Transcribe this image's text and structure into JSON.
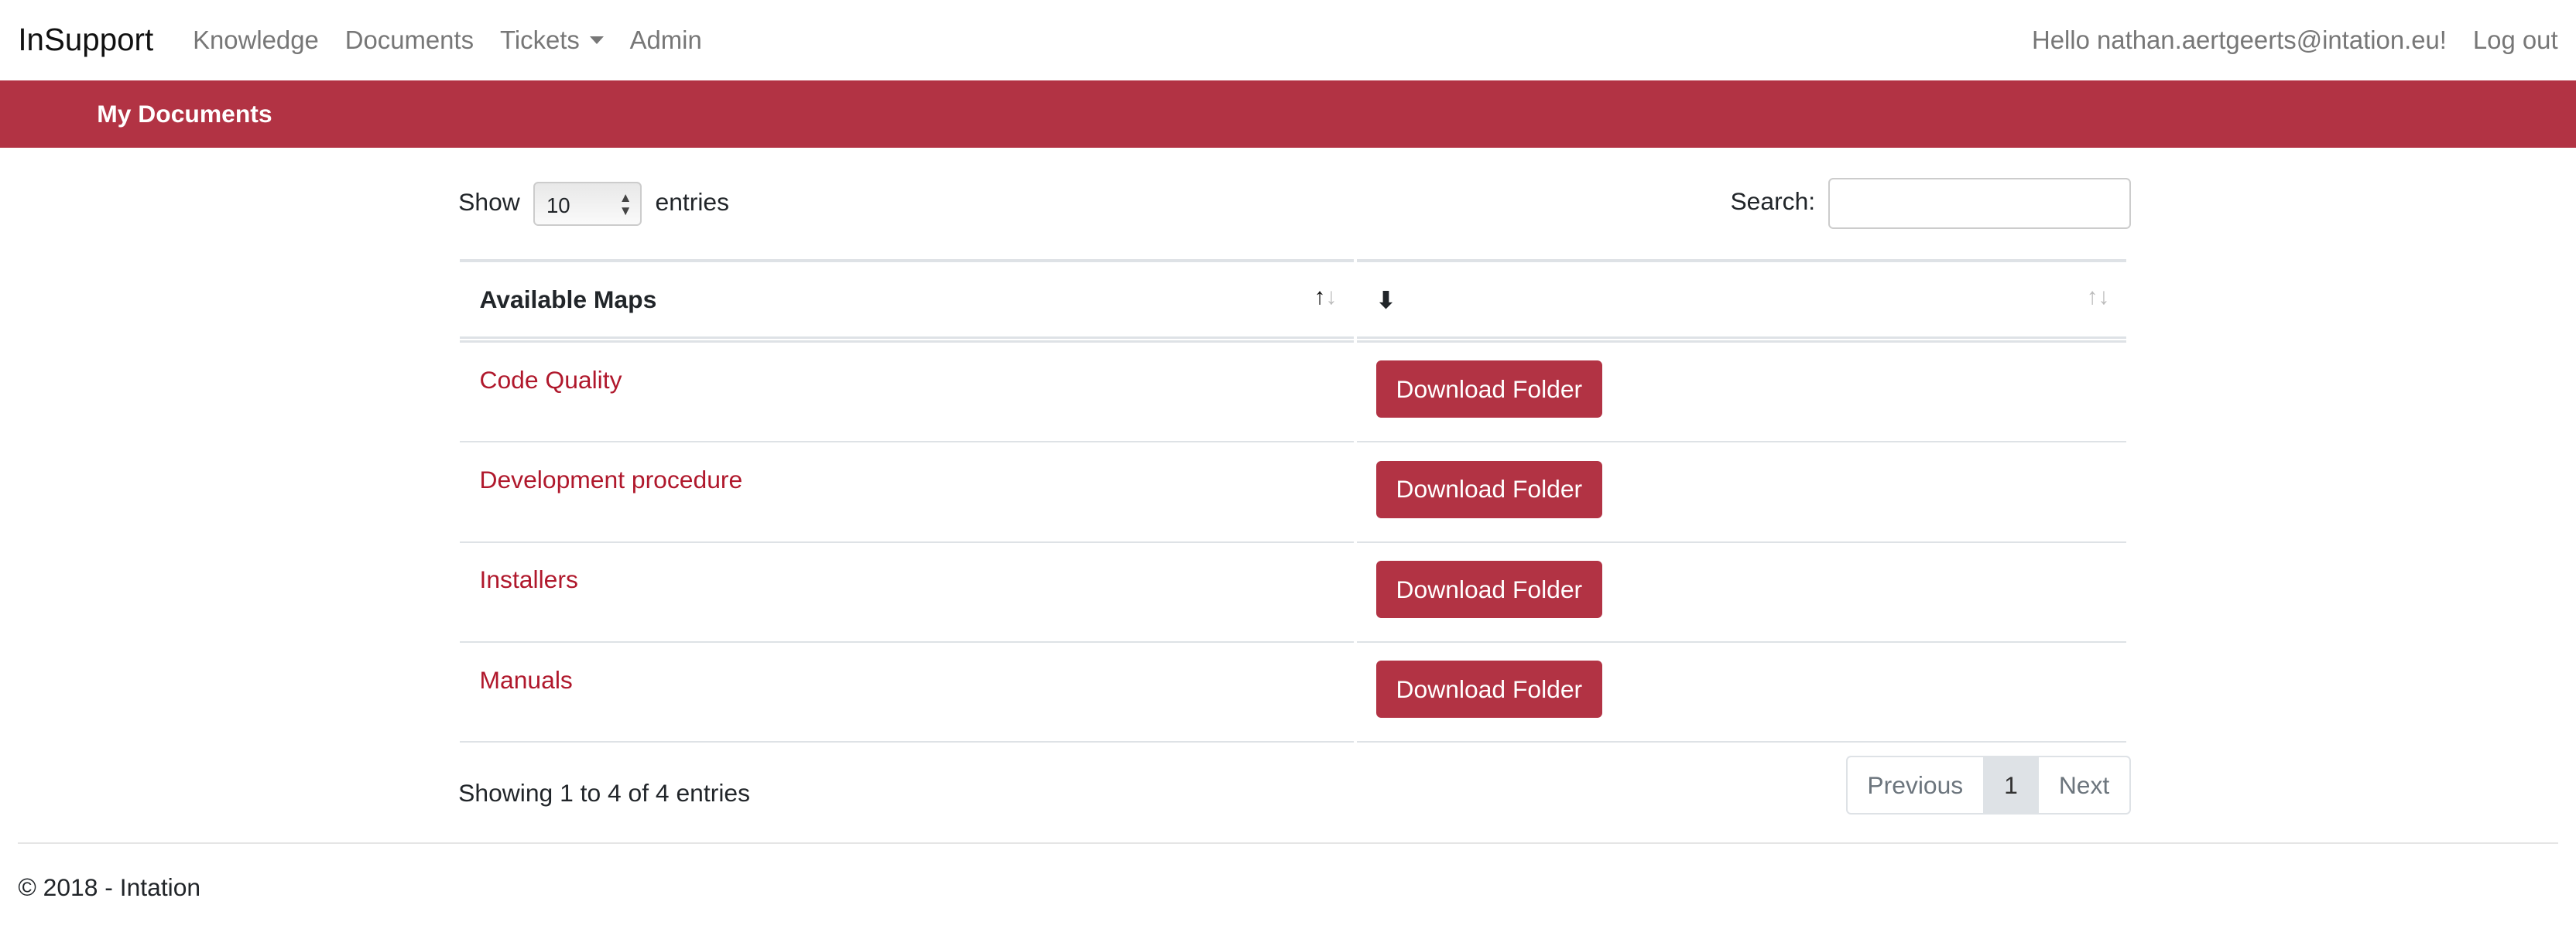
{
  "nav": {
    "brand": "InSupport",
    "items": [
      "Knowledge",
      "Documents",
      "Tickets",
      "Admin"
    ],
    "greeting": "Hello nathan.aertgeerts@intation.eu!",
    "logout": "Log out"
  },
  "banner": {
    "title": "My Documents"
  },
  "table_controls": {
    "show": "Show",
    "length": "10",
    "entries": "entries",
    "search_label": "Search:",
    "search_value": ""
  },
  "table": {
    "headers": [
      "Available Maps",
      ""
    ],
    "rows": [
      {
        "name": "Code Quality",
        "action": "Download Folder"
      },
      {
        "name": "Development procedure",
        "action": "Download Folder"
      },
      {
        "name": "Installers",
        "action": "Download Folder"
      },
      {
        "name": "Manuals",
        "action": "Download Folder"
      }
    ]
  },
  "info": "Showing 1 to 4 of 4 entries",
  "pagination": {
    "previous": "Previous",
    "current": "1",
    "next": "Next"
  },
  "footer": "© 2018 - Intation",
  "colors": {
    "brand": "#b23344",
    "link": "#b0182c"
  }
}
